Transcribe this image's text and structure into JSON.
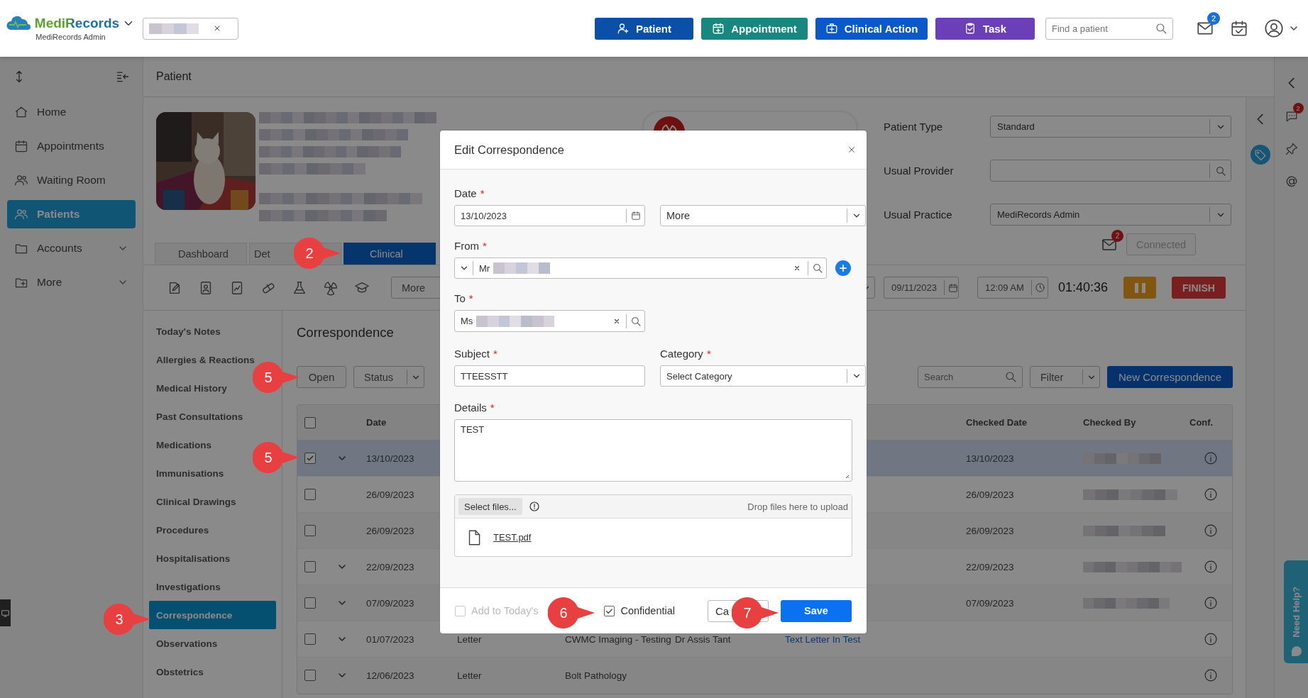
{
  "app": {
    "brand": "MediRecords",
    "subtitle": "MediRecords Admin"
  },
  "topbar": {
    "actions": [
      {
        "label": "Patient",
        "color": "#0a4fa8"
      },
      {
        "label": "Appointment",
        "color": "#17877f"
      },
      {
        "label": "Clinical Action",
        "color": "#0b58c9"
      },
      {
        "label": "Task",
        "color": "#6b3fb8"
      }
    ],
    "search": {
      "placeholder": "Find a patient"
    },
    "mail_badge": "2"
  },
  "sidebar": {
    "items": [
      {
        "label": "Home",
        "selected": false,
        "expandable": false
      },
      {
        "label": "Appointments",
        "selected": false,
        "expandable": false
      },
      {
        "label": "Waiting Room",
        "selected": false,
        "expandable": false
      },
      {
        "label": "Patients",
        "selected": true,
        "expandable": false
      },
      {
        "label": "Accounts",
        "selected": false,
        "expandable": true
      },
      {
        "label": "More",
        "selected": false,
        "expandable": true
      }
    ]
  },
  "page": {
    "title": "Patient"
  },
  "patient": {
    "fields": [
      {
        "label": "Patient Type",
        "value": "Standard",
        "kind": "select"
      },
      {
        "label": "Usual Provider",
        "kind": "search"
      },
      {
        "label": "Usual Practice",
        "value": "MediRecords Admin",
        "kind": "select"
      }
    ],
    "inbox_badge": "2",
    "connection": "Connected"
  },
  "tabs": [
    {
      "label": "Dashboard",
      "selected": false
    },
    {
      "label": "Det",
      "selected": false
    },
    {
      "label": "Clinical",
      "selected": true
    }
  ],
  "toolbar": {
    "more": "More",
    "date": "09/11/2023",
    "time": "12:09 AM",
    "timer": "01:40:36",
    "finish": "FINISH"
  },
  "clinical_nav": {
    "items": [
      {
        "label": "Today's Notes",
        "selected": false
      },
      {
        "label": "Allergies & Reactions",
        "selected": false
      },
      {
        "label": "Medical History",
        "selected": false
      },
      {
        "label": "Past Consultations",
        "selected": false
      },
      {
        "label": "Medications",
        "selected": false
      },
      {
        "label": "Immunisations",
        "selected": false
      },
      {
        "label": "Clinical Drawings",
        "selected": false
      },
      {
        "label": "Procedures",
        "selected": false
      },
      {
        "label": "Hospitalisations",
        "selected": false
      },
      {
        "label": "Investigations",
        "selected": false
      },
      {
        "label": "Correspondence",
        "selected": true
      },
      {
        "label": "Observations",
        "selected": false
      },
      {
        "label": "Obstetrics",
        "selected": false
      }
    ]
  },
  "correspondence": {
    "title": "Correspondence",
    "open": "Open",
    "status": "Status",
    "search": {
      "placeholder": "Search"
    },
    "filter": "Filter",
    "new": "New Correspondence",
    "select_all": {
      "checked": false
    },
    "columns": [
      "Date",
      "Checked Date",
      "Checked By",
      "Conf."
    ],
    "rows": [
      {
        "date": "13/10/2023",
        "checked": true,
        "selected": true,
        "expandable": true,
        "checked_date": "13/10/2023"
      },
      {
        "date": "26/09/2023",
        "checked": false,
        "selected": false,
        "expandable": false,
        "checked_date": "26/09/2023"
      },
      {
        "date": "26/09/2023",
        "checked": false,
        "selected": false,
        "expandable": false,
        "checked_date": "26/09/2023"
      },
      {
        "date": "22/09/2023",
        "checked": false,
        "selected": false,
        "expandable": true,
        "checked_date": "22/09/2023"
      },
      {
        "date": "07/09/2023",
        "checked": false,
        "selected": false,
        "expandable": true,
        "checked_date": "07/09/2023"
      },
      {
        "date": "01/07/2023",
        "checked": false,
        "selected": false,
        "expandable": true,
        "type": "Letter",
        "from": "CWMC Imaging - Testing",
        "author": "Dr Assis Tant",
        "subject": "Text Letter In Test"
      },
      {
        "date": "12/06/2023",
        "checked": false,
        "selected": false,
        "expandable": true,
        "type": "Letter",
        "from": "Bolt Pathology"
      }
    ]
  },
  "modal": {
    "title": "Edit Correspondence",
    "date": {
      "label": "Date",
      "required_mark": "*",
      "value": "13/10/2023"
    },
    "more": "More",
    "from": {
      "label": "From",
      "required_mark": "*",
      "prefix": "Mr"
    },
    "to": {
      "label": "To",
      "required_mark": "*",
      "prefix": "Ms"
    },
    "subject": {
      "label": "Subject",
      "required_mark": "*",
      "value": "TTEESSTT"
    },
    "category": {
      "label": "Category",
      "required_mark": "*",
      "placeholder": "Select Category"
    },
    "details": {
      "label": "Details",
      "required_mark": "*",
      "value": "TEST"
    },
    "upload": {
      "button": "Select files...",
      "hint": "Drop files here to upload",
      "files": [
        "TEST.pdf"
      ]
    },
    "add_to_notes": {
      "label": "Add to Today's",
      "checked": false,
      "disabled": true
    },
    "confidential": {
      "label": "Confidential",
      "checked": true
    },
    "cancel": "Ca",
    "save": "Save"
  },
  "callouts": [
    "2",
    "5",
    "5",
    "3",
    "6",
    "7"
  ],
  "right_rail": {
    "chat_badge": "2",
    "help": "Need Help?"
  }
}
